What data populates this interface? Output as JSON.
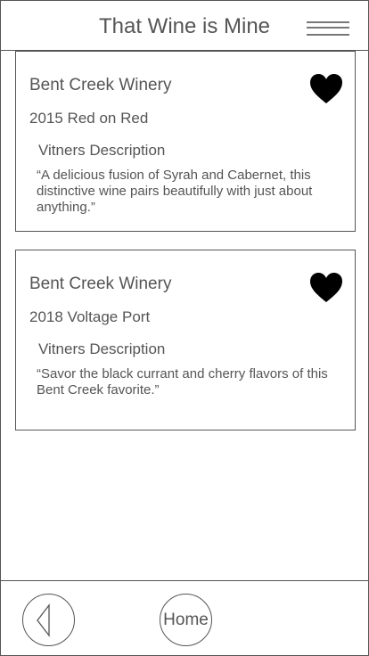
{
  "header": {
    "title": "That Wine is Mine",
    "menu_icon": "hamburger-menu-icon"
  },
  "wines": [
    {
      "winery": "Bent Creek Winery",
      "name": "2015 Red on Red",
      "description_label": "Vitners Description",
      "description": "“A delicious fusion of Syrah and Cabernet, this distinctive wine pairs beautifully with just about anything.”",
      "favorite_icon": "heart-icon",
      "favorited": true
    },
    {
      "winery": "Bent Creek Winery",
      "name": "2018 Voltage Port",
      "description_label": "Vitners Description",
      "description": "“Savor the black currant and cherry flavors of this Bent Creek favorite.”",
      "favorite_icon": "heart-icon",
      "favorited": true
    }
  ],
  "footer": {
    "back_icon": "back-arrow-icon",
    "home_label": "Home"
  },
  "colors": {
    "stroke": "#555555",
    "text": "#555555",
    "heart": "#000000",
    "background": "#ffffff"
  }
}
